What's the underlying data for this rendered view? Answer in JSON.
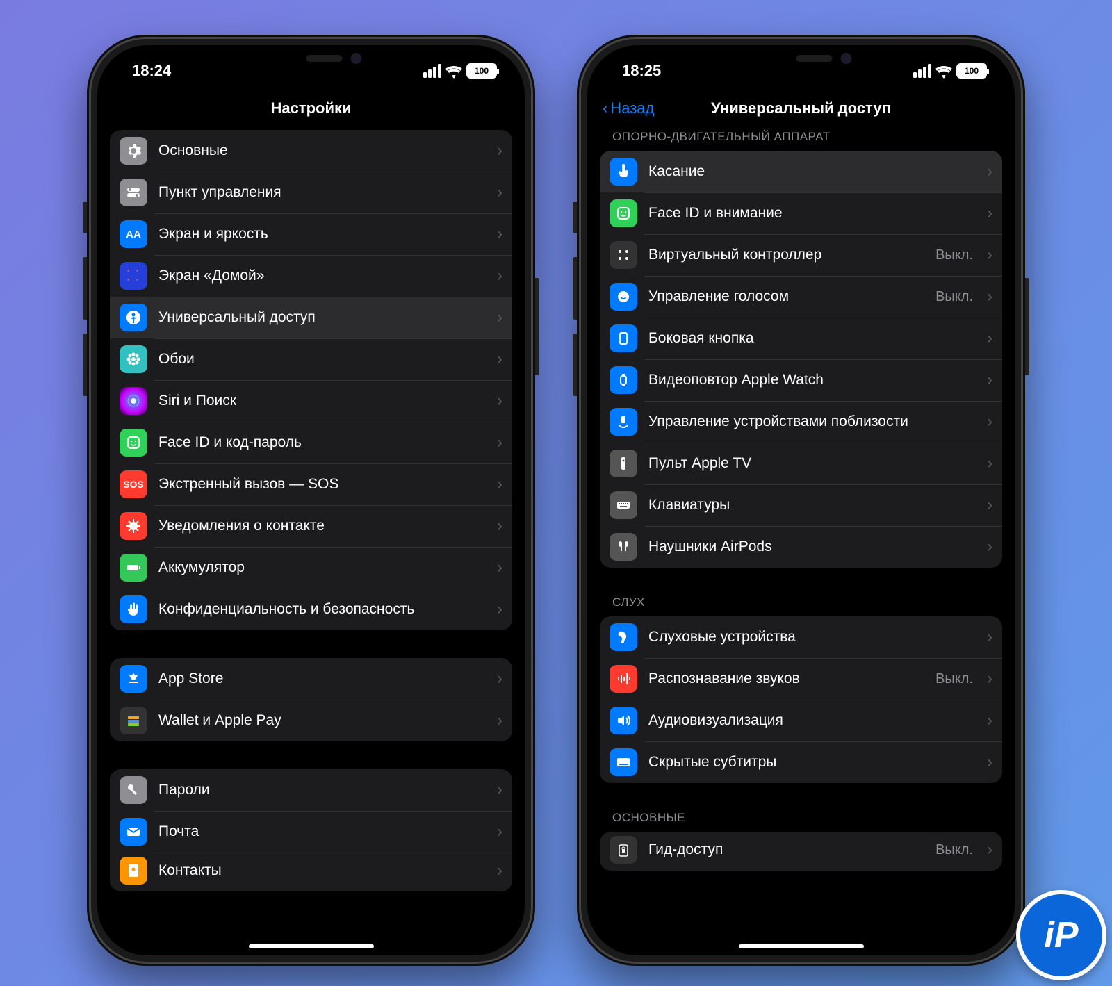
{
  "left": {
    "time": "18:24",
    "battery": "100",
    "title": "Настройки",
    "groups": [
      {
        "id": "g1",
        "items": [
          {
            "name": "general",
            "icon": "gear",
            "bg": "i-gray",
            "label": "Основные"
          },
          {
            "name": "control-center",
            "icon": "switches",
            "bg": "i-gray",
            "label": "Пункт управления"
          },
          {
            "name": "display",
            "icon": "aa",
            "bg": "i-blue",
            "label": "Экран и яркость"
          },
          {
            "name": "home-screen",
            "icon": "grid",
            "bg": "i-home",
            "label": "Экран «Домой»"
          },
          {
            "name": "accessibility",
            "icon": "person",
            "bg": "i-blue",
            "label": "Универсальный доступ",
            "hl": true
          },
          {
            "name": "wallpaper",
            "icon": "flower",
            "bg": "i-teal",
            "label": "Обои"
          },
          {
            "name": "siri",
            "icon": "siri",
            "bg": "i-siri",
            "label": "Siri и Поиск"
          },
          {
            "name": "faceid",
            "icon": "face",
            "bg": "i-face",
            "label": "Face ID и код-пароль"
          },
          {
            "name": "sos",
            "icon": "sos",
            "bg": "i-red",
            "label": "Экстренный вызов — SOS"
          },
          {
            "name": "exposure",
            "icon": "virus",
            "bg": "i-red",
            "label": "Уведомления о контакте"
          },
          {
            "name": "battery",
            "icon": "batt",
            "bg": "i-green",
            "label": "Аккумулятор"
          },
          {
            "name": "privacy",
            "icon": "hand",
            "bg": "i-blue",
            "label": "Конфиденциальность и безопасность"
          }
        ]
      },
      {
        "id": "g2",
        "items": [
          {
            "name": "app-store",
            "icon": "store",
            "bg": "i-blue",
            "label": "App Store"
          },
          {
            "name": "wallet",
            "icon": "wallet",
            "bg": "i-dark",
            "label": "Wallet и Apple Pay"
          }
        ]
      },
      {
        "id": "g3",
        "items": [
          {
            "name": "passwords",
            "icon": "key",
            "bg": "i-gray",
            "label": "Пароли"
          },
          {
            "name": "mail",
            "icon": "mail",
            "bg": "i-blue",
            "label": "Почта"
          },
          {
            "name": "contacts",
            "icon": "contacts",
            "bg": "i-orange",
            "label": "Контакты",
            "partial": true
          }
        ]
      }
    ]
  },
  "right": {
    "time": "18:25",
    "battery": "100",
    "back": "Назад",
    "title": "Универсальный доступ",
    "groups": [
      {
        "id": "m1",
        "head": "Опорно-двигательный аппарат",
        "items": [
          {
            "name": "touch",
            "icon": "touch",
            "bg": "i-blue",
            "label": "Касание",
            "hl": true
          },
          {
            "name": "face-attn",
            "icon": "face",
            "bg": "i-face",
            "label": "Face ID и внимание"
          },
          {
            "name": "virtual-controller",
            "icon": "gamepad",
            "bg": "i-dark",
            "label": "Виртуальный контроллер",
            "value": "Выкл."
          },
          {
            "name": "voice-control",
            "icon": "voice",
            "bg": "i-blue",
            "label": "Управление голосом",
            "value": "Выкл."
          },
          {
            "name": "side-button",
            "icon": "side",
            "bg": "i-blue",
            "label": "Боковая кнопка"
          },
          {
            "name": "watch-mirror",
            "icon": "watch",
            "bg": "i-blue",
            "label": "Видеоповтор Apple Watch"
          },
          {
            "name": "nearby-devices",
            "icon": "nearby",
            "bg": "i-blue",
            "label": "Управление устройствами поблизости"
          },
          {
            "name": "apple-tv-remote",
            "icon": "remote",
            "bg": "i-dgray",
            "label": "Пульт Apple TV"
          },
          {
            "name": "keyboards",
            "icon": "keyboard",
            "bg": "i-dgray",
            "label": "Клавиатуры"
          },
          {
            "name": "airpods",
            "icon": "airpods",
            "bg": "i-dgray",
            "label": "Наушники AirPods"
          }
        ]
      },
      {
        "id": "m2",
        "head": "Слух",
        "items": [
          {
            "name": "hearing",
            "icon": "ear",
            "bg": "i-blue",
            "label": "Слуховые устройства"
          },
          {
            "name": "sound-recog",
            "icon": "sound",
            "bg": "i-red",
            "label": "Распознавание звуков",
            "value": "Выкл."
          },
          {
            "name": "audio-visual",
            "icon": "speaker",
            "bg": "i-blue",
            "label": "Аудиовизуализация"
          },
          {
            "name": "subtitles",
            "icon": "cc",
            "bg": "i-blue",
            "label": "Скрытые субтитры"
          }
        ]
      },
      {
        "id": "m3",
        "head": "Основные",
        "items": [
          {
            "name": "guided-access",
            "icon": "lock",
            "bg": "i-dark",
            "label": "Гид-доступ",
            "value": "Выкл.",
            "partial": true
          }
        ]
      }
    ]
  },
  "watermark": "iP"
}
